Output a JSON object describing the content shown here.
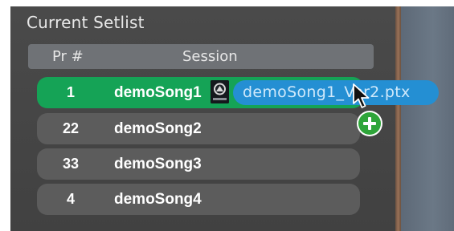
{
  "setlist": {
    "title": "Current Setlist",
    "columns": {
      "pr": "Pr #",
      "session": "Session"
    },
    "rows": [
      {
        "pr": "1",
        "song": "demoSong1",
        "active": true
      },
      {
        "pr": "22",
        "song": "demoSong2",
        "active": false
      },
      {
        "pr": "33",
        "song": "demoSong3",
        "active": false
      },
      {
        "pr": "4",
        "song": "demoSong4",
        "active": false
      }
    ]
  },
  "drag": {
    "filename": "demoSong1_Ver2.ptx",
    "icon": "pro-tools-session-file-icon",
    "badge_icon": "plus-icon",
    "cursor_icon": "arrow-cursor-icon"
  },
  "colors": {
    "active_row": "#15a356",
    "row": "#5c5c5c",
    "drag_pill": "#248fd3",
    "plus_badge": "#2fa53a"
  }
}
